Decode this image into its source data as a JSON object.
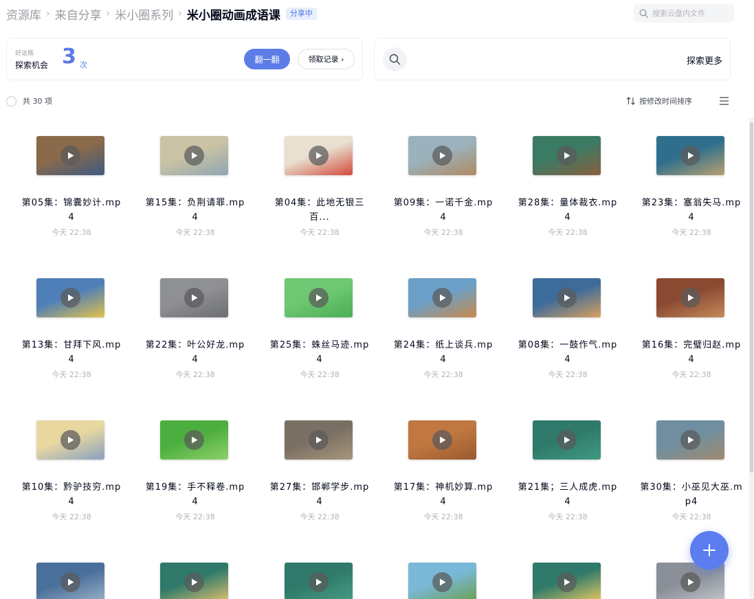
{
  "breadcrumb": {
    "items": [
      "资源库",
      "来自分享",
      "米小圈系列"
    ],
    "current": "米小圈动画成语课",
    "badge": "分享中"
  },
  "search": {
    "placeholder": "搜索云盘内文件",
    "icon": "search-icon"
  },
  "lucky": {
    "small_label": "好运瓶",
    "label": "探索机会",
    "count": "3",
    "unit": "次",
    "flip_button": "翻一翻",
    "record_button": "领取记录 ›"
  },
  "explore": {
    "icon": "search-icon",
    "more_label": "探索更多"
  },
  "toolbar": {
    "total": "共 30 项",
    "sort": "按修改时间排序",
    "sort_icon": "sort-arrows-icon",
    "view_icon": "list-view-icon"
  },
  "files": [
    {
      "name": "第05集：锦囊妙计.mp4",
      "time": "今天 22:38",
      "color1": "#8a6a4a",
      "color2": "#3f5a82"
    },
    {
      "name": "第15集：负荆请罪.mp4",
      "time": "今天 22:38",
      "color1": "#c9c2a4",
      "color2": "#8fa6b2"
    },
    {
      "name": "第04集：此地无银三百...",
      "time": "今天 22:38",
      "color1": "#e8e0d0",
      "color2": "#d34a3a"
    },
    {
      "name": "第09集：一诺千金.mp4",
      "time": "今天 22:38",
      "color1": "#9bb2bd",
      "color2": "#b08a60"
    },
    {
      "name": "第28集：量体裁衣.mp4",
      "time": "今天 22:38",
      "color1": "#3b7a63",
      "color2": "#8a5f3e"
    },
    {
      "name": "第23集：塞翁失马.mp4",
      "time": "今天 22:38",
      "color1": "#2f6f8d",
      "color2": "#b8a070"
    },
    {
      "name": "第13集：甘拜下风.mp4",
      "time": "今天 22:38",
      "color1": "#4f7fb8",
      "color2": "#e2c24a"
    },
    {
      "name": "第22集：叶公好龙.mp4",
      "time": "今天 22:38",
      "color1": "#8f9094",
      "color2": "#6c6e73"
    },
    {
      "name": "第25集：蛛丝马迹.mp4",
      "time": "今天 22:38",
      "color1": "#6ec873",
      "color2": "#4bae55"
    },
    {
      "name": "第24集：纸上谈兵.mp4",
      "time": "今天 22:38",
      "color1": "#6aa0c8",
      "color2": "#c98a4a"
    },
    {
      "name": "第08集：一鼓作气.mp4",
      "time": "今天 22:38",
      "color1": "#3d6b9a",
      "color2": "#d9a060"
    },
    {
      "name": "第16集：完璧归赵.mp4",
      "time": "今天 22:38",
      "color1": "#8a4a32",
      "color2": "#c48a5a"
    },
    {
      "name": "第10集：黔驴技穷.mp4",
      "time": "今天 22:38",
      "color1": "#e8d8a0",
      "color2": "#8aa0c0"
    },
    {
      "name": "第19集：手不释卷.mp4",
      "time": "今天 22:38",
      "color1": "#4cae3e",
      "color2": "#8fd06a"
    },
    {
      "name": "第27集：邯郸学步.mp4",
      "time": "今天 22:38",
      "color1": "#7a6f64",
      "color2": "#a8967a"
    },
    {
      "name": "第17集：神机妙算.mp4",
      "time": "今天 22:38",
      "color1": "#c07840",
      "color2": "#9a5a30"
    },
    {
      "name": "第21集；三人成虎.mp4",
      "time": "今天 22:38",
      "color1": "#2f7a6a",
      "color2": "#3e9a80"
    },
    {
      "name": "第30集：小巫见大巫.mp4",
      "time": "今天 22:38",
      "color1": "#6f8fa0",
      "color2": "#a08a70"
    },
    {
      "name": "",
      "time": "",
      "color1": "#4a6f9a",
      "color2": "#9ab0c8"
    },
    {
      "name": "",
      "time": "",
      "color1": "#2f7a6a",
      "color2": "#e0c070"
    },
    {
      "name": "",
      "time": "",
      "color1": "#2f7a6a",
      "color2": "#4a9a84"
    },
    {
      "name": "",
      "time": "",
      "color1": "#7ab8d8",
      "color2": "#6aa050"
    },
    {
      "name": "",
      "time": "",
      "color1": "#2f7a6a",
      "color2": "#e8c860"
    },
    {
      "name": "",
      "time": "",
      "color1": "#8a8f98",
      "color2": "#c0c4ca"
    }
  ],
  "fab": {
    "icon": "plus-icon"
  },
  "colors": {
    "accent": "#5b7df0",
    "badge_bg": "#e8eefd",
    "muted_text": "#b0b3ba"
  }
}
